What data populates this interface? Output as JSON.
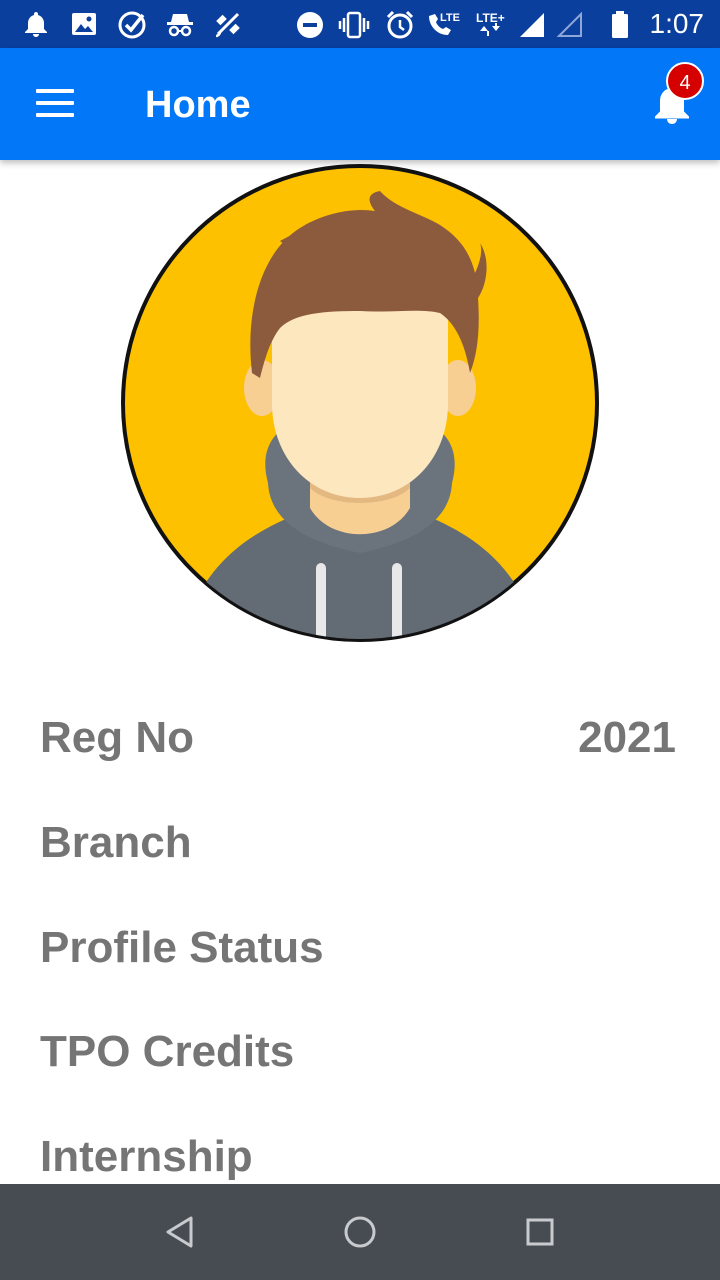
{
  "status_bar": {
    "time": "1:07",
    "left_icons": [
      "bell-icon",
      "image-icon",
      "check-circle-icon",
      "incognito-icon",
      "satellite-icon"
    ],
    "right_icons": [
      "do-not-disturb-icon",
      "vibrate-icon",
      "alarm-icon",
      "volte-call-icon",
      "lte-plus-icon",
      "signal-icon",
      "signal-empty-icon",
      "battery-icon"
    ],
    "call_network_label": "LTE",
    "data_network_label": "LTE+"
  },
  "app_bar": {
    "title": "Home",
    "notification_count": "4",
    "background_color": "#0277f7"
  },
  "profile": {
    "avatar": "user-avatar-placeholder",
    "rows": [
      {
        "label": "Reg No",
        "value": "2021"
      },
      {
        "label": "Branch",
        "value": ""
      },
      {
        "label": "Profile Status",
        "value": ""
      },
      {
        "label": "TPO Credits",
        "value": ""
      },
      {
        "label": "Internship",
        "value": ""
      }
    ]
  },
  "nav_bar": {
    "buttons": [
      "back-icon",
      "home-icon",
      "recents-icon"
    ]
  }
}
